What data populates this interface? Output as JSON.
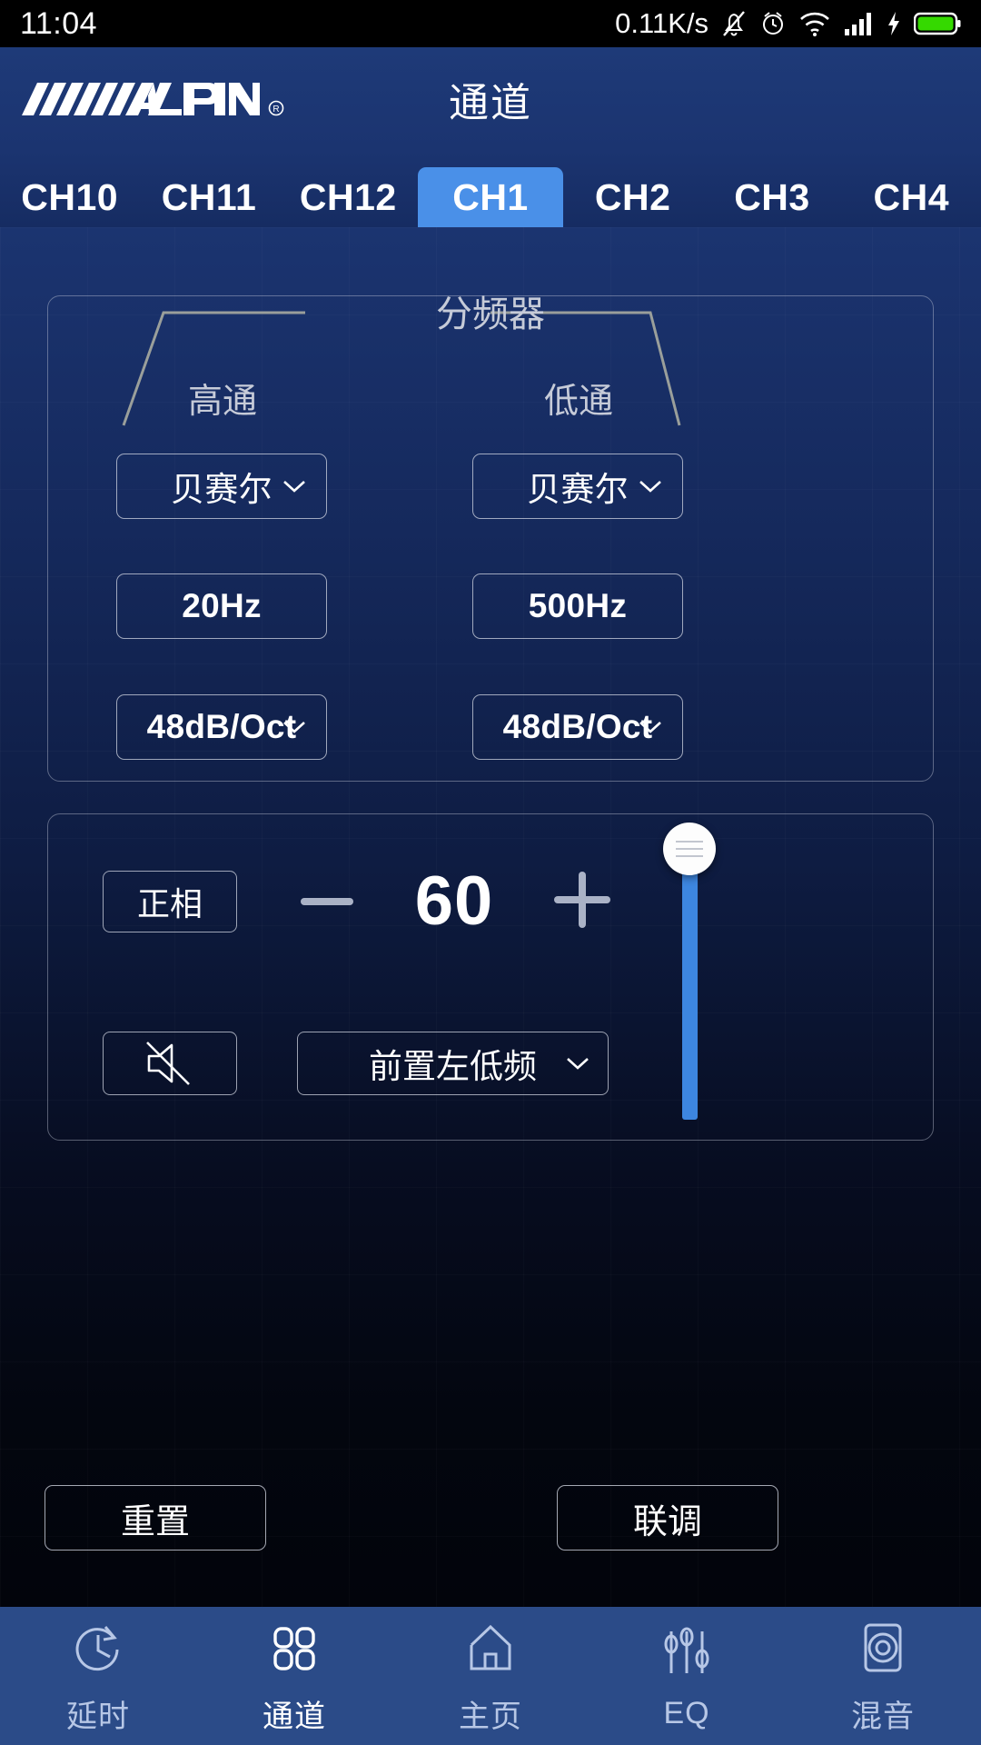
{
  "status_bar": {
    "time": "11:04",
    "network_speed": "0.11K/s",
    "icons": [
      "bell-muted-icon",
      "alarm-clock-icon",
      "wifi-icon",
      "cellular-signal-icon",
      "charging-bolt-icon",
      "battery-icon"
    ]
  },
  "header": {
    "brand": "ALPINE",
    "brand_mark": "®",
    "title": "通道"
  },
  "tabs": {
    "items": [
      {
        "label": "CH10",
        "active": false
      },
      {
        "label": "CH11",
        "active": false
      },
      {
        "label": "CH12",
        "active": false
      },
      {
        "label": "CH1",
        "active": true
      },
      {
        "label": "CH2",
        "active": false
      },
      {
        "label": "CH3",
        "active": false
      },
      {
        "label": "CH4",
        "active": false
      }
    ]
  },
  "crossover": {
    "title": "分频器",
    "high_pass": {
      "label": "高通",
      "filter_type": "贝赛尔",
      "frequency": "20Hz",
      "slope": "48dB/Oct"
    },
    "low_pass": {
      "label": "低通",
      "filter_type": "贝赛尔",
      "frequency": "500Hz",
      "slope": "48dB/Oct"
    }
  },
  "level": {
    "phase_label": "正相",
    "minus_label": "−",
    "plus_label": "+",
    "value": "60",
    "mute_icon": "speaker-muted-icon",
    "output_channel": "前置左低频",
    "slider_icon": "slider-thumb-icon"
  },
  "actions": {
    "reset": "重置",
    "link": "联调"
  },
  "bottom_nav": {
    "items": [
      {
        "label": "延时",
        "icon": "clock-delay-icon",
        "active": false
      },
      {
        "label": "通道",
        "icon": "grid-channels-icon",
        "active": true
      },
      {
        "label": "主页",
        "icon": "home-icon",
        "active": false
      },
      {
        "label": "EQ",
        "icon": "equalizer-icon",
        "active": false
      },
      {
        "label": "混音",
        "icon": "speaker-mixer-icon",
        "active": false
      }
    ]
  },
  "colors": {
    "accent": "#4a90e8",
    "header_blue": "#1e3a78",
    "nav_blue": "#2b4b88",
    "battery_green": "#35d900"
  }
}
